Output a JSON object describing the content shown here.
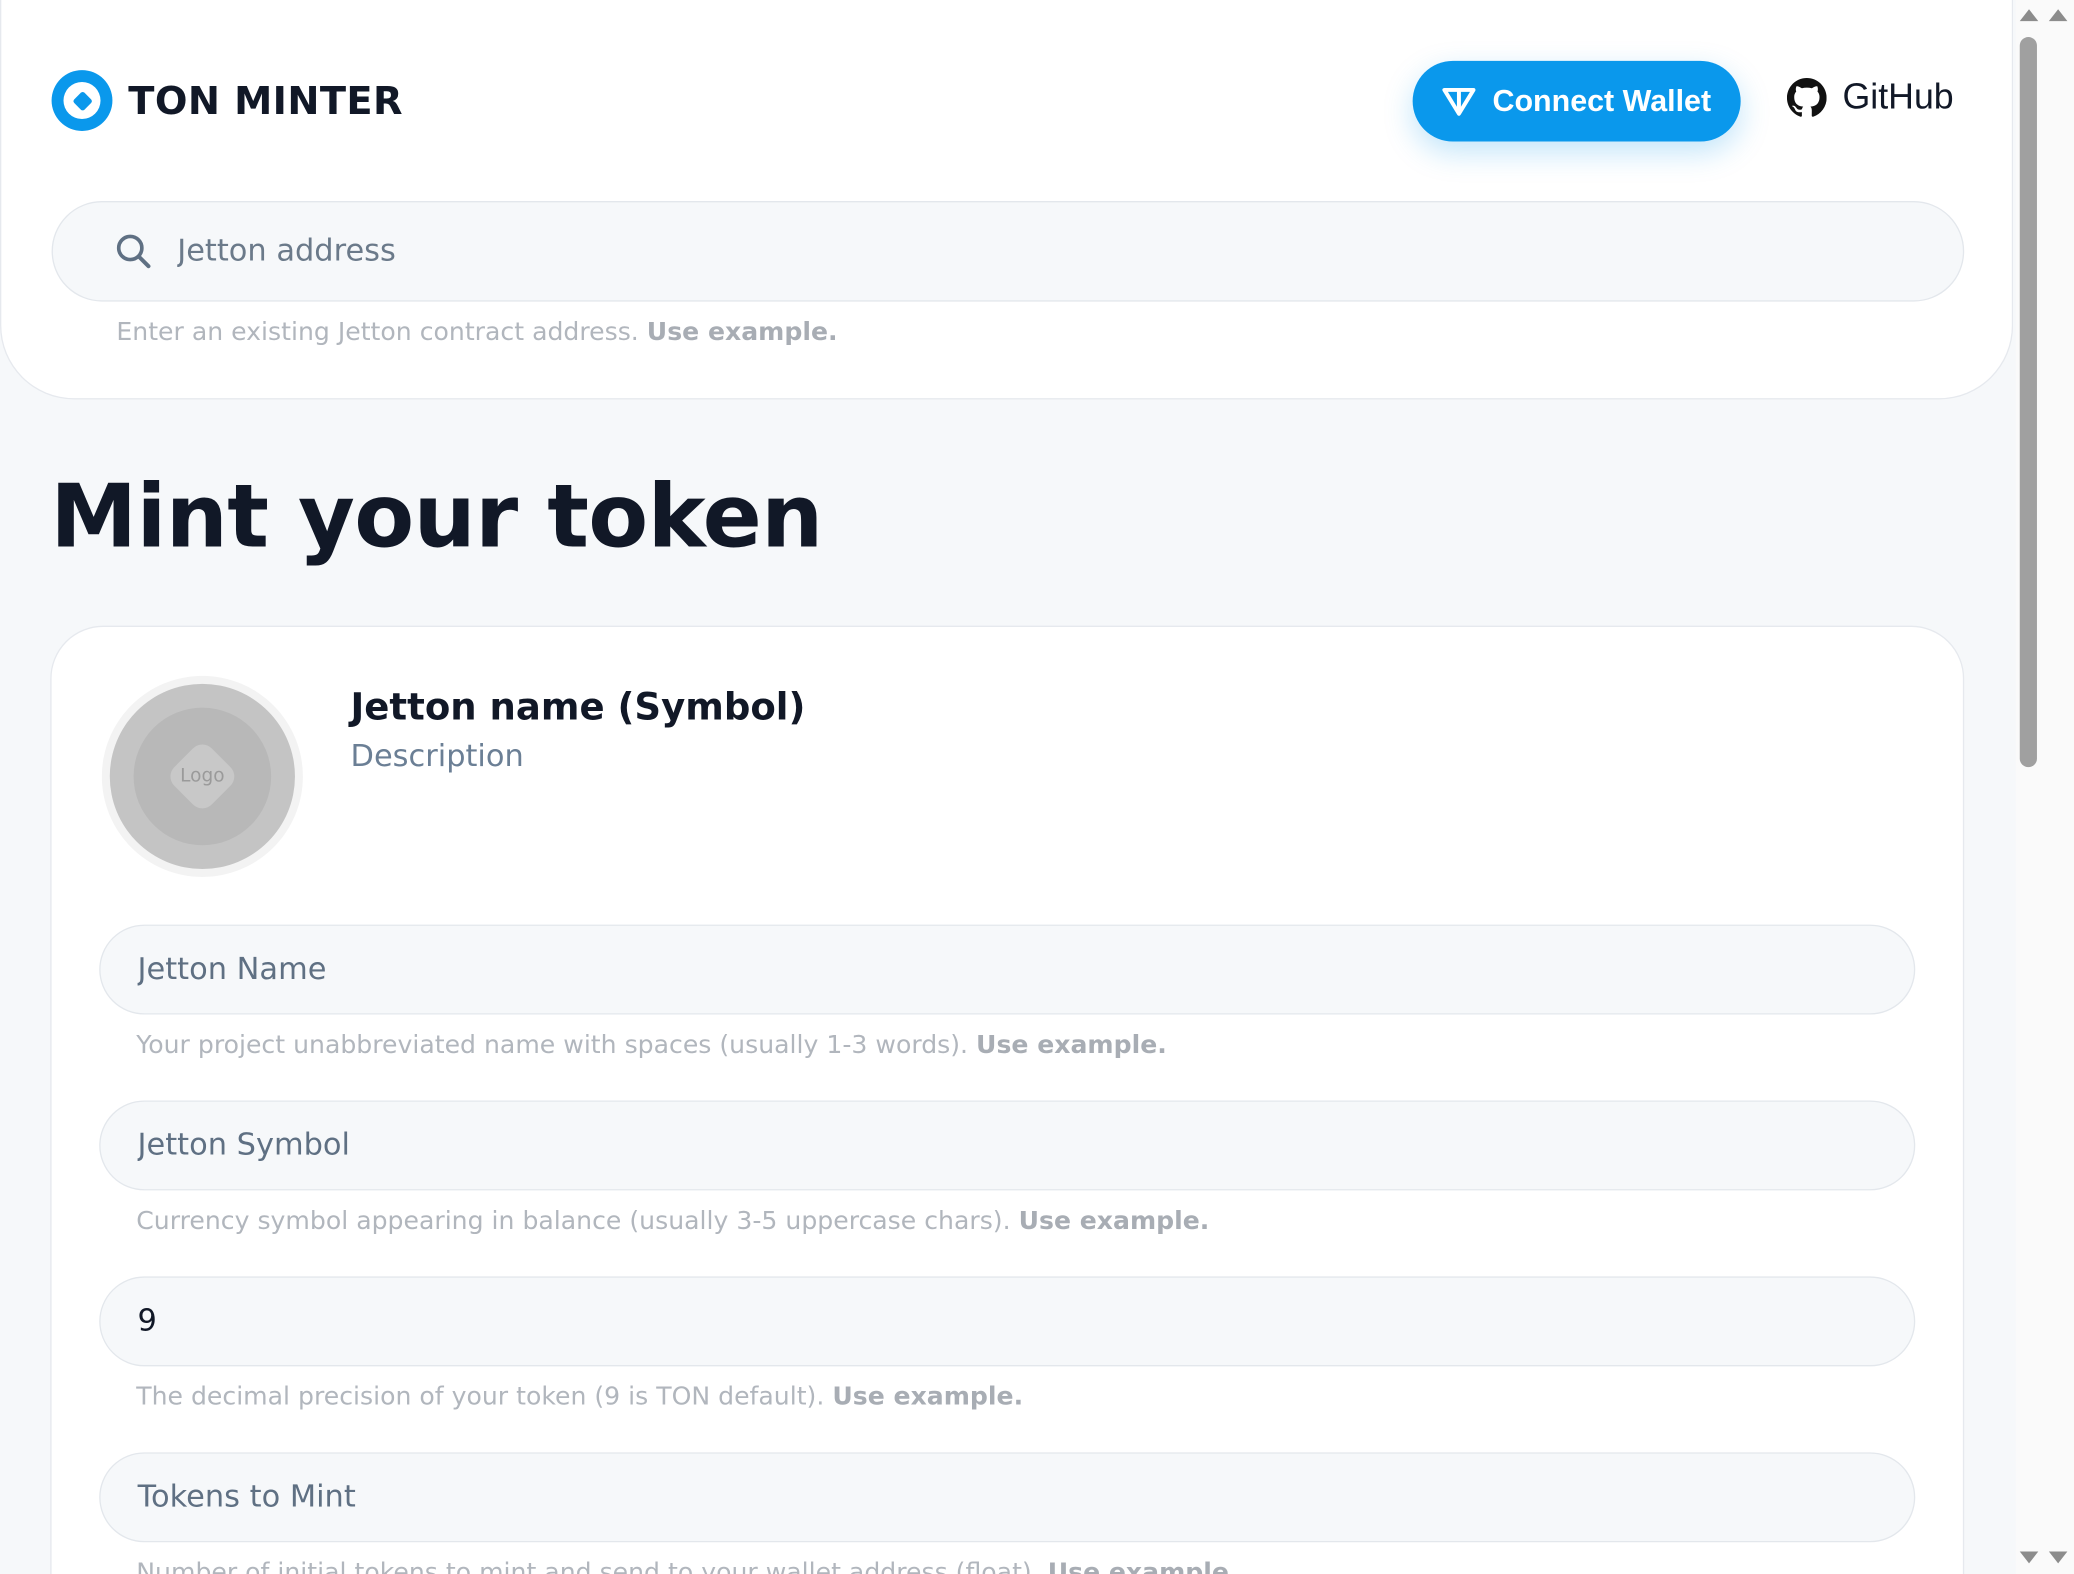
{
  "header": {
    "brand": "TON MINTER",
    "connect_label": "Connect Wallet",
    "github_label": "GitHub"
  },
  "search": {
    "placeholder": "Jetton address",
    "hint": "Enter an existing Jetton contract address.",
    "hint_link": "Use example."
  },
  "page_title": "Mint your token",
  "token_preview": {
    "logo_label": "Logo",
    "title": "Jetton name (Symbol)",
    "description": "Description"
  },
  "fields": [
    {
      "placeholder": "Jetton Name",
      "value": "",
      "hint": "Your project unabbreviated name with spaces (usually 1-3 words).",
      "hint_link": "Use example."
    },
    {
      "placeholder": "Jetton Symbol",
      "value": "",
      "hint": "Currency symbol appearing in balance (usually 3-5 uppercase chars).",
      "hint_link": "Use example."
    },
    {
      "placeholder": "",
      "value": "9",
      "hint": "The decimal precision of your token (9 is TON default).",
      "hint_link": "Use example."
    },
    {
      "placeholder": "Tokens to Mint",
      "value": "",
      "hint": "Number of initial tokens to mint and send to your wallet address (float).",
      "hint_link": "Use example."
    }
  ],
  "colors": {
    "accent": "#0a98ec",
    "title_text": "#111827",
    "hint_text": "#b1b6bd"
  }
}
